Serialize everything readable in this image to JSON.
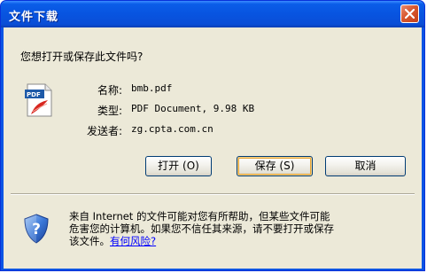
{
  "window": {
    "title": "文件下载"
  },
  "dialog": {
    "question": "您想打开或保存此文件吗?",
    "file": {
      "icon": "pdf-file-icon",
      "name_label": "名称:",
      "name_value": "bmb.pdf",
      "type_label": "类型:",
      "type_value": "PDF Document, 9.98 KB",
      "from_label": "发送者:",
      "from_value": "zg.cpta.com.cn"
    },
    "buttons": {
      "open_label": "打开",
      "open_key": "(O)",
      "save_label": "保存",
      "save_key": "(S)",
      "cancel_label": "取消"
    },
    "warning": {
      "icon": "security-shield-icon",
      "line1": "来自 Internet 的文件可能对您有所帮助，但某些文件可能",
      "line2": "危害您的计算机。如果您不信任其来源，请不要打开或保存",
      "line3_prefix": "该文件。",
      "risk_link": "有何风险?"
    }
  },
  "colors": {
    "titlebar": "#0854e0",
    "client_bg": "#ece9d8",
    "close_button": "#d8572f",
    "link": "#0000ff"
  }
}
